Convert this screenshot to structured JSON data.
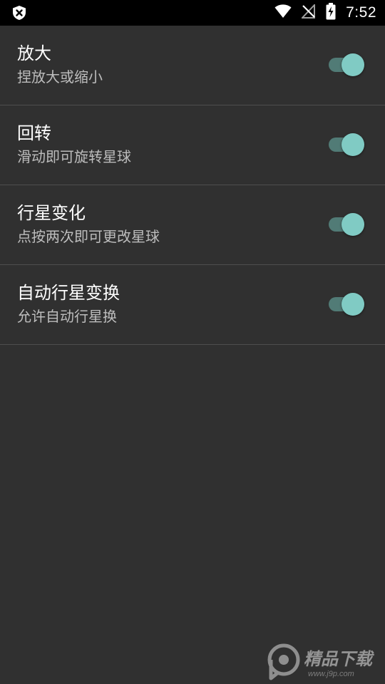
{
  "status_bar": {
    "time": "7:52",
    "icons": [
      "shield-x-icon",
      "wifi-icon",
      "no-signal-icon",
      "battery-charging-icon"
    ]
  },
  "settings": [
    {
      "title": "放大",
      "summary": "捏放大或缩小",
      "enabled": true
    },
    {
      "title": "回转",
      "summary": "滑动即可旋转星球",
      "enabled": true
    },
    {
      "title": "行星变化",
      "summary": "点按两次即可更改星球",
      "enabled": true
    },
    {
      "title": "自动行星变换",
      "summary": "允许自动行星换",
      "enabled": true
    }
  ],
  "watermark": {
    "text": "精品下载",
    "url": "www.j9p.com"
  },
  "colors": {
    "background": "#303030",
    "status_bar": "#000000",
    "divider": "#4e4e4e",
    "toggle_thumb": "#80cbc4",
    "toggle_track": "#517b76"
  }
}
